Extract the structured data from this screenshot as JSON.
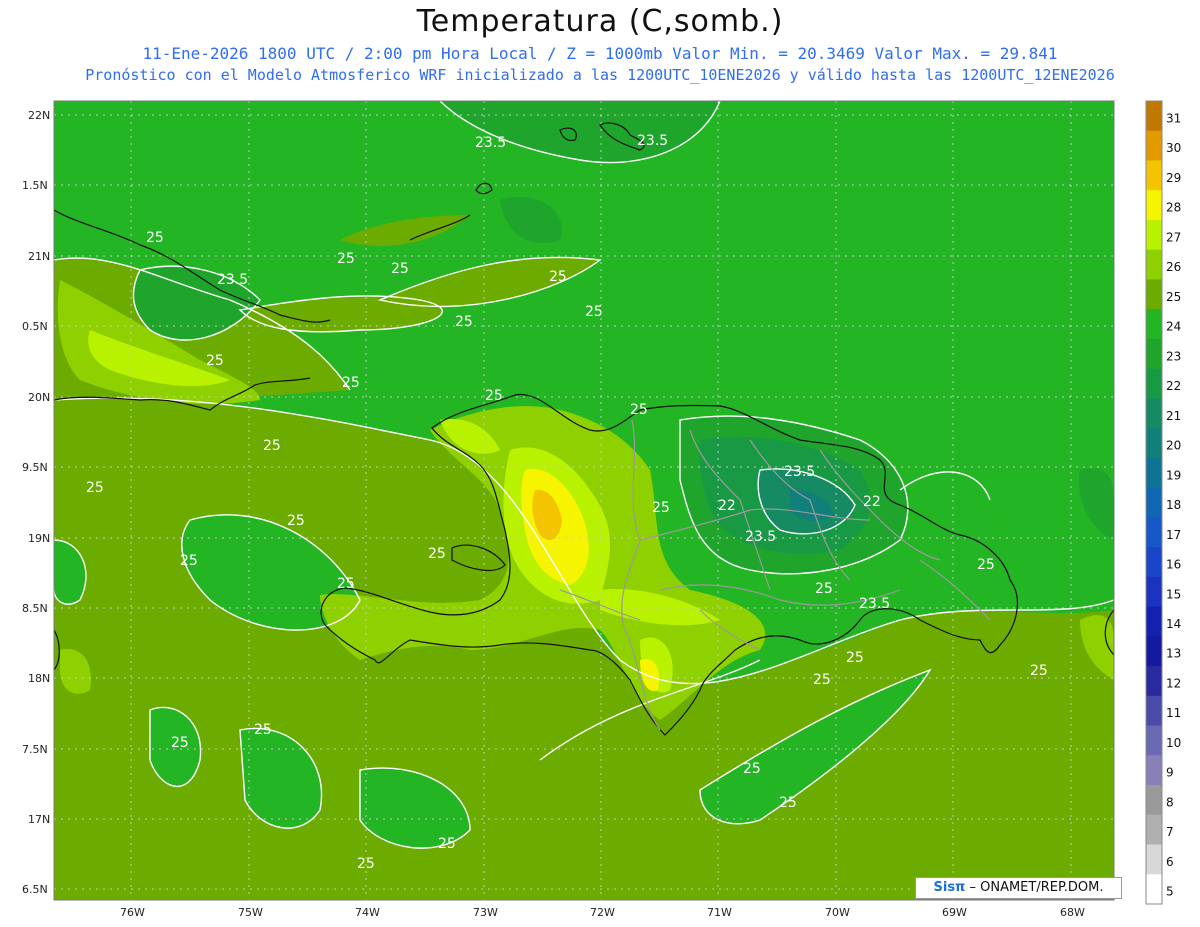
{
  "header": {
    "title": "Temperatura (C,somb.)",
    "line1": "11-Ene-2026  1800 UTC / 2:00 pm Hora Local / Z = 1000mb   Valor Min. = 20.3469  Valor Max. = 29.841",
    "line2": "Pronóstico con el Modelo Atmosferico WRF inicializado a las 1200UTC_10ENE2026 y válido hasta las  1200UTC_12ENE2026"
  },
  "axes": {
    "lat_labels": [
      "22N",
      "1.5N",
      "21N",
      "0.5N",
      "20N",
      "9.5N",
      "19N",
      "8.5N",
      "18N",
      "7.5N",
      "17N",
      "6.5N"
    ],
    "lon_labels": [
      "76W",
      "75W",
      "74W",
      "73W",
      "72W",
      "71W",
      "70W",
      "69W",
      "68W"
    ]
  },
  "contour_labels": [
    "25",
    "23.5",
    "22"
  ],
  "colorbar": {
    "levels": [
      "31",
      "30",
      "29",
      "28",
      "27",
      "26",
      "25",
      "24",
      "23",
      "22",
      "21",
      "20",
      "19",
      "18",
      "17",
      "16",
      "15",
      "14",
      "13",
      "12",
      "11",
      "10",
      "9",
      "8",
      "7",
      "6",
      "5"
    ],
    "colors": [
      "#c07800",
      "#e29a00",
      "#f5c400",
      "#f7f400",
      "#b8f200",
      "#8fd000",
      "#6cac00",
      "#23b523",
      "#1fa52b",
      "#189a45",
      "#168a63",
      "#11807a",
      "#0e7395",
      "#1166b4",
      "#1758c8",
      "#1b45c8",
      "#1b33c0",
      "#1420b0",
      "#141aa0",
      "#2a2aa0",
      "#4a4aa8",
      "#6a6ab4",
      "#8a80b8",
      "#9a9a9a",
      "#b0b0b0",
      "#d8d8d8",
      "#ffffff"
    ]
  },
  "credit": {
    "logo": "Sisπ",
    "text": " – ONAMET/REP.DOM."
  },
  "colors": {
    "land_coast": "#111111",
    "province_lines": "#9a9a9a",
    "contour": "#ffffff",
    "accent_text": "#2f6df2"
  }
}
